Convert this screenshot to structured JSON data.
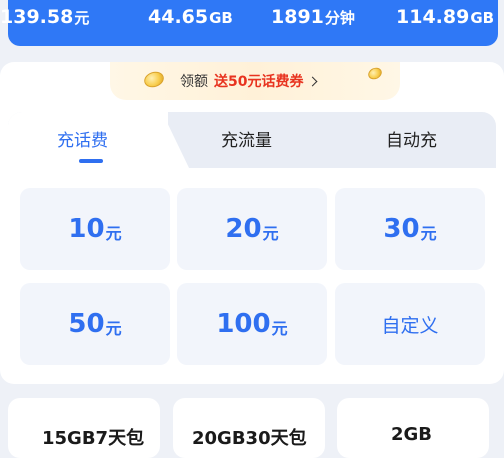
{
  "balance": {
    "stats": [
      {
        "value": "139.58",
        "unit": "元"
      },
      {
        "value": "44.65",
        "unit": "GB"
      },
      {
        "value": "1891",
        "unit": "分钟"
      },
      {
        "value": "114.89",
        "unit": "GB"
      }
    ],
    "accent_color": "#2f78f6"
  },
  "promo": {
    "prefix": "领额",
    "highlight": "送50元话费券",
    "icon": "chevron-right-icon",
    "highlight_color": "#e8331f"
  },
  "tabs": [
    {
      "label": "充话费",
      "active": true
    },
    {
      "label": "充流量",
      "active": false
    },
    {
      "label": "自动充",
      "active": false
    }
  ],
  "amounts": [
    {
      "value": "10",
      "unit": "元"
    },
    {
      "value": "20",
      "unit": "元"
    },
    {
      "value": "30",
      "unit": "元"
    },
    {
      "value": "50",
      "unit": "元"
    },
    {
      "value": "100",
      "unit": "元"
    }
  ],
  "custom_label": "自定义",
  "packages": [
    {
      "title": "15GB7天包"
    },
    {
      "title": "20GB30天包"
    },
    {
      "title": "2GB"
    }
  ],
  "tile_text_color": "#2f6ff0"
}
